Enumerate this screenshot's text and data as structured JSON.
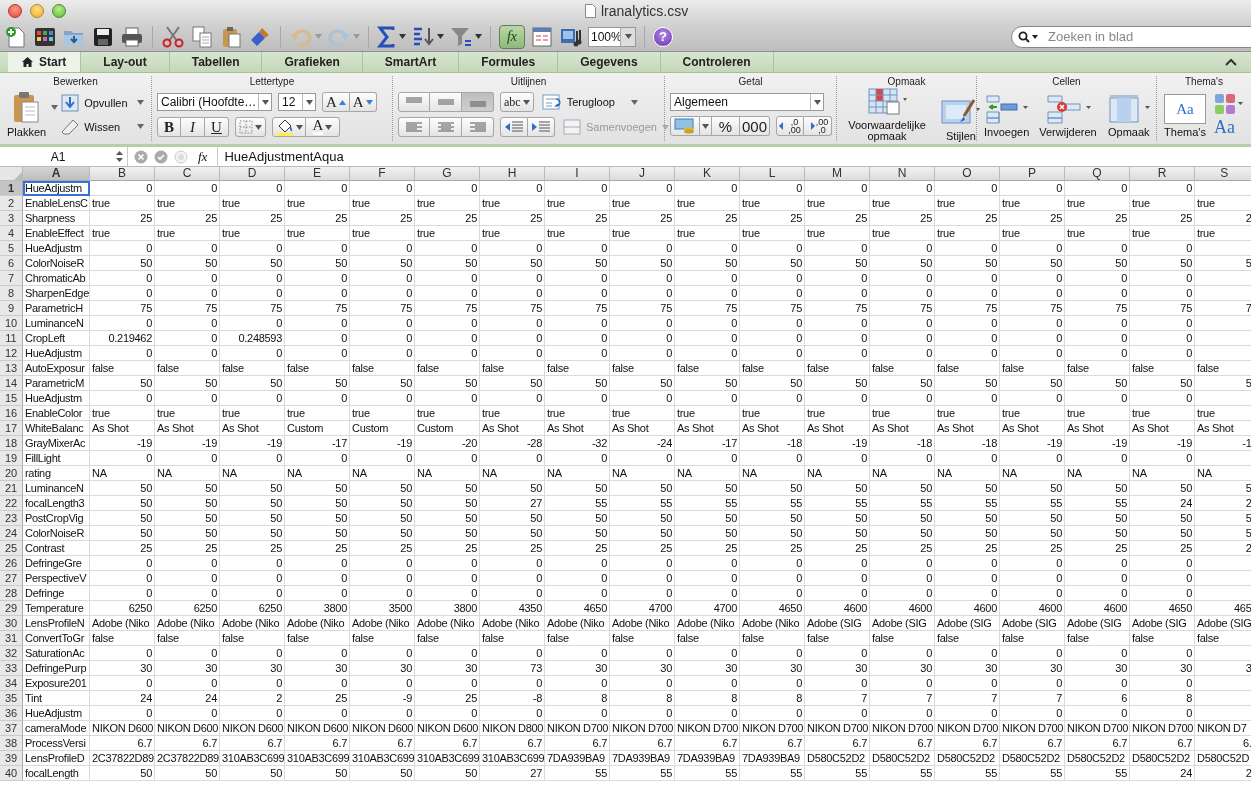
{
  "window": {
    "title": "lranalytics.csv"
  },
  "toolbar": {
    "zoom": "100%",
    "formula_toggle": {
      "label": "fx",
      "selected": true
    },
    "help": "?",
    "search": {
      "placeholder": "Zoeken in blad"
    }
  },
  "tabs": [
    {
      "label": "Start",
      "selected": true
    },
    {
      "label": "Lay-out",
      "selected": false
    },
    {
      "label": "Tabellen",
      "selected": false
    },
    {
      "label": "Grafieken",
      "selected": false
    },
    {
      "label": "SmartArt",
      "selected": false
    },
    {
      "label": "Formules",
      "selected": false
    },
    {
      "label": "Gegevens",
      "selected": false
    },
    {
      "label": "Controleren",
      "selected": false
    }
  ],
  "ribbon": {
    "edit": {
      "title": "Bewerken",
      "paste": "Plakken",
      "fill": "Opvullen",
      "clear": "Wissen"
    },
    "font": {
      "title": "Lettertype",
      "font_name": "Calibri (Hoofdte…",
      "font_size": "12",
      "grow": "A",
      "shrink": "A",
      "bold": "B",
      "italic": "I",
      "underline": "U",
      "font_color": "A"
    },
    "alignment": {
      "title": "Uitlijnen",
      "vertical_align": [
        {
          "selected": false
        },
        {
          "selected": false
        },
        {
          "selected": true
        }
      ],
      "orientation": "abc",
      "wrap": "Terugloop",
      "merge": {
        "label": "Samenvoegen",
        "disabled": true
      }
    },
    "number": {
      "title": "Getal",
      "format": "Algemeen",
      "percent": "%",
      "thousands": "000",
      "increase_decimal": [
        ",0",
        ",00"
      ],
      "decrease_decimal": [
        ",00",
        ",0"
      ]
    },
    "styles": {
      "title": "Opmaak",
      "conditional": "Voorwaardelijke opmaak",
      "styles": "Stijlen"
    },
    "cells": {
      "title": "Cellen",
      "insert": "Invoegen",
      "delete": "Verwijderen",
      "format": "Opmaak"
    },
    "themes": {
      "title": "Thema's",
      "preview": "Aa",
      "themes": "Thema's",
      "fonts": "Aa"
    }
  },
  "formula_bar": {
    "name_box": "A1",
    "fx": "fx",
    "formula": "HueAdjustmentAqua"
  },
  "sheet": {
    "columns": [
      {
        "label": "A",
        "selected": true
      },
      {
        "label": "B",
        "selected": false
      },
      {
        "label": "C",
        "selected": false
      },
      {
        "label": "D",
        "selected": false
      },
      {
        "label": "E",
        "selected": false
      },
      {
        "label": "F",
        "selected": false
      },
      {
        "label": "G",
        "selected": false
      },
      {
        "label": "H",
        "selected": false
      },
      {
        "label": "I",
        "selected": false
      },
      {
        "label": "J",
        "selected": false
      },
      {
        "label": "K",
        "selected": false
      },
      {
        "label": "L",
        "selected": false
      },
      {
        "label": "M",
        "selected": false
      },
      {
        "label": "N",
        "selected": false
      },
      {
        "label": "O",
        "selected": false
      },
      {
        "label": "P",
        "selected": false
      },
      {
        "label": "Q",
        "selected": false
      },
      {
        "label": "R",
        "selected": false
      },
      {
        "label": "S",
        "selected": false
      }
    ],
    "rows": [
      {
        "number": "1",
        "selected": true,
        "label": "HueAdjustm",
        "kind": "number",
        "cells": [
          "0",
          "0",
          "0",
          "0",
          "0",
          "0",
          "0",
          "0",
          "0",
          "0",
          "0",
          "0",
          "0",
          "0",
          "0",
          "0",
          "0"
        ]
      },
      {
        "number": "2",
        "selected": false,
        "label": "EnableLensC",
        "kind": "text",
        "cells": [
          "true",
          "true",
          "true",
          "true",
          "true",
          "true",
          "true",
          "true",
          "true",
          "true",
          "true",
          "true",
          "true",
          "true",
          "true",
          "true",
          "true",
          "true"
        ]
      },
      {
        "number": "3",
        "selected": false,
        "label": "Sharpness",
        "kind": "number",
        "cells": [
          "25",
          "25",
          "25",
          "25",
          "25",
          "25",
          "25",
          "25",
          "25",
          "25",
          "25",
          "25",
          "25",
          "25",
          "25",
          "25",
          "25",
          "2"
        ]
      },
      {
        "number": "4",
        "selected": false,
        "label": "EnableEffect",
        "kind": "text",
        "cells": [
          "true",
          "true",
          "true",
          "true",
          "true",
          "true",
          "true",
          "true",
          "true",
          "true",
          "true",
          "true",
          "true",
          "true",
          "true",
          "true",
          "true",
          "true"
        ]
      },
      {
        "number": "5",
        "selected": false,
        "label": "HueAdjustm",
        "kind": "number",
        "cells": [
          "0",
          "0",
          "0",
          "0",
          "0",
          "0",
          "0",
          "0",
          "0",
          "0",
          "0",
          "0",
          "0",
          "0",
          "0",
          "0",
          "0"
        ]
      },
      {
        "number": "6",
        "selected": false,
        "label": "ColorNoiseR",
        "kind": "number",
        "cells": [
          "50",
          "50",
          "50",
          "50",
          "50",
          "50",
          "50",
          "50",
          "50",
          "50",
          "50",
          "50",
          "50",
          "50",
          "50",
          "50",
          "50",
          "5"
        ]
      },
      {
        "number": "7",
        "selected": false,
        "label": "ChromaticAb",
        "kind": "number",
        "cells": [
          "0",
          "0",
          "0",
          "0",
          "0",
          "0",
          "0",
          "0",
          "0",
          "0",
          "0",
          "0",
          "0",
          "0",
          "0",
          "0",
          "0"
        ]
      },
      {
        "number": "8",
        "selected": false,
        "label": "SharpenEdge",
        "kind": "number",
        "cells": [
          "0",
          "0",
          "0",
          "0",
          "0",
          "0",
          "0",
          "0",
          "0",
          "0",
          "0",
          "0",
          "0",
          "0",
          "0",
          "0",
          "0"
        ]
      },
      {
        "number": "9",
        "selected": false,
        "label": "ParametricH",
        "kind": "number",
        "cells": [
          "75",
          "75",
          "75",
          "75",
          "75",
          "75",
          "75",
          "75",
          "75",
          "75",
          "75",
          "75",
          "75",
          "75",
          "75",
          "75",
          "75",
          "7"
        ]
      },
      {
        "number": "10",
        "selected": false,
        "label": "LuminanceN",
        "kind": "number",
        "cells": [
          "0",
          "0",
          "0",
          "0",
          "0",
          "0",
          "0",
          "0",
          "0",
          "0",
          "0",
          "0",
          "0",
          "0",
          "0",
          "0",
          "0"
        ]
      },
      {
        "number": "11",
        "selected": false,
        "label": "CropLeft",
        "kind": "number",
        "cells": [
          "0.219462",
          "0",
          "0.248593",
          "0",
          "0",
          "0",
          "0",
          "0",
          "0",
          "0",
          "0",
          "0",
          "0",
          "0",
          "0",
          "0",
          "0"
        ]
      },
      {
        "number": "12",
        "selected": false,
        "label": "HueAdjustm",
        "kind": "number",
        "cells": [
          "0",
          "0",
          "0",
          "0",
          "0",
          "0",
          "0",
          "0",
          "0",
          "0",
          "0",
          "0",
          "0",
          "0",
          "0",
          "0",
          "0"
        ]
      },
      {
        "number": "13",
        "selected": false,
        "label": "AutoExposur",
        "kind": "text",
        "cells": [
          "false",
          "false",
          "false",
          "false",
          "false",
          "false",
          "false",
          "false",
          "false",
          "false",
          "false",
          "false",
          "false",
          "false",
          "false",
          "false",
          "false",
          "false"
        ]
      },
      {
        "number": "14",
        "selected": false,
        "label": "ParametricM",
        "kind": "number",
        "cells": [
          "50",
          "50",
          "50",
          "50",
          "50",
          "50",
          "50",
          "50",
          "50",
          "50",
          "50",
          "50",
          "50",
          "50",
          "50",
          "50",
          "50",
          "5"
        ]
      },
      {
        "number": "15",
        "selected": false,
        "label": "HueAdjustm",
        "kind": "number",
        "cells": [
          "0",
          "0",
          "0",
          "0",
          "0",
          "0",
          "0",
          "0",
          "0",
          "0",
          "0",
          "0",
          "0",
          "0",
          "0",
          "0",
          "0"
        ]
      },
      {
        "number": "16",
        "selected": false,
        "label": "EnableColor",
        "kind": "text",
        "cells": [
          "true",
          "true",
          "true",
          "true",
          "true",
          "true",
          "true",
          "true",
          "true",
          "true",
          "true",
          "true",
          "true",
          "true",
          "true",
          "true",
          "true",
          "true"
        ]
      },
      {
        "number": "17",
        "selected": false,
        "label": "WhiteBalanc",
        "kind": "text",
        "cells": [
          "As Shot",
          "As Shot",
          "As Shot",
          "Custom",
          "Custom",
          "Custom",
          "As Shot",
          "As Shot",
          "As Shot",
          "As Shot",
          "As Shot",
          "As Shot",
          "As Shot",
          "As Shot",
          "As Shot",
          "As Shot",
          "As Shot",
          "As Shot"
        ]
      },
      {
        "number": "18",
        "selected": false,
        "label": "GrayMixerAc",
        "kind": "number",
        "cells": [
          "-19",
          "-19",
          "-19",
          "-17",
          "-19",
          "-20",
          "-28",
          "-32",
          "-24",
          "-17",
          "-18",
          "-19",
          "-18",
          "-18",
          "-19",
          "-19",
          "-19",
          "-1"
        ]
      },
      {
        "number": "19",
        "selected": false,
        "label": "FillLight",
        "kind": "number",
        "cells": [
          "0",
          "0",
          "0",
          "0",
          "0",
          "0",
          "0",
          "0",
          "0",
          "0",
          "0",
          "0",
          "0",
          "0",
          "0",
          "0",
          "0"
        ]
      },
      {
        "number": "20",
        "selected": false,
        "label": "rating",
        "kind": "text",
        "cells": [
          "NA",
          "NA",
          "NA",
          "NA",
          "NA",
          "NA",
          "NA",
          "NA",
          "NA",
          "NA",
          "NA",
          "NA",
          "NA",
          "NA",
          "NA",
          "NA",
          "NA",
          "NA"
        ]
      },
      {
        "number": "21",
        "selected": false,
        "label": "LuminanceN",
        "kind": "number",
        "cells": [
          "50",
          "50",
          "50",
          "50",
          "50",
          "50",
          "50",
          "50",
          "50",
          "50",
          "50",
          "50",
          "50",
          "50",
          "50",
          "50",
          "50",
          "5"
        ]
      },
      {
        "number": "22",
        "selected": false,
        "label": "focalLength3",
        "kind": "number",
        "cells": [
          "50",
          "50",
          "50",
          "50",
          "50",
          "50",
          "27",
          "55",
          "55",
          "55",
          "55",
          "55",
          "55",
          "55",
          "55",
          "55",
          "24",
          "2"
        ]
      },
      {
        "number": "23",
        "selected": false,
        "label": "PostCropVig",
        "kind": "number",
        "cells": [
          "50",
          "50",
          "50",
          "50",
          "50",
          "50",
          "50",
          "50",
          "50",
          "50",
          "50",
          "50",
          "50",
          "50",
          "50",
          "50",
          "50",
          "5"
        ]
      },
      {
        "number": "24",
        "selected": false,
        "label": "ColorNoiseR",
        "kind": "number",
        "cells": [
          "50",
          "50",
          "50",
          "50",
          "50",
          "50",
          "50",
          "50",
          "50",
          "50",
          "50",
          "50",
          "50",
          "50",
          "50",
          "50",
          "50",
          "5"
        ]
      },
      {
        "number": "25",
        "selected": false,
        "label": "Contrast",
        "kind": "number",
        "cells": [
          "25",
          "25",
          "25",
          "25",
          "25",
          "25",
          "25",
          "25",
          "25",
          "25",
          "25",
          "25",
          "25",
          "25",
          "25",
          "25",
          "25",
          "2"
        ]
      },
      {
        "number": "26",
        "selected": false,
        "label": "DefringeGre",
        "kind": "number",
        "cells": [
          "0",
          "0",
          "0",
          "0",
          "0",
          "0",
          "0",
          "0",
          "0",
          "0",
          "0",
          "0",
          "0",
          "0",
          "0",
          "0",
          "0"
        ]
      },
      {
        "number": "27",
        "selected": false,
        "label": "PerspectiveV",
        "kind": "number",
        "cells": [
          "0",
          "0",
          "0",
          "0",
          "0",
          "0",
          "0",
          "0",
          "0",
          "0",
          "0",
          "0",
          "0",
          "0",
          "0",
          "0",
          "0"
        ]
      },
      {
        "number": "28",
        "selected": false,
        "label": "Defringe",
        "kind": "number",
        "cells": [
          "0",
          "0",
          "0",
          "0",
          "0",
          "0",
          "0",
          "0",
          "0",
          "0",
          "0",
          "0",
          "0",
          "0",
          "0",
          "0",
          "0"
        ]
      },
      {
        "number": "29",
        "selected": false,
        "label": "Temperature",
        "kind": "number",
        "cells": [
          "6250",
          "6250",
          "6250",
          "3800",
          "3500",
          "3800",
          "4350",
          "4650",
          "4700",
          "4700",
          "4650",
          "4600",
          "4600",
          "4600",
          "4600",
          "4600",
          "4650",
          "465"
        ]
      },
      {
        "number": "30",
        "selected": false,
        "label": "LensProfileN",
        "kind": "text",
        "cells": [
          "Adobe (Niko",
          "Adobe (Niko",
          "Adobe (Niko",
          "Adobe (Niko",
          "Adobe (Niko",
          "Adobe (Niko",
          "Adobe (Niko",
          "Adobe (Niko",
          "Adobe (Niko",
          "Adobe (Niko",
          "Adobe (Niko",
          "Adobe (SIG",
          "Adobe (SIG",
          "Adobe (SIG",
          "Adobe (SIG",
          "Adobe (SIG",
          "Adobe (SIG",
          "Adobe (SIG"
        ]
      },
      {
        "number": "31",
        "selected": false,
        "label": "ConvertToGr",
        "kind": "text",
        "cells": [
          "false",
          "false",
          "false",
          "false",
          "false",
          "false",
          "false",
          "false",
          "false",
          "false",
          "false",
          "false",
          "false",
          "false",
          "false",
          "false",
          "false",
          "false"
        ]
      },
      {
        "number": "32",
        "selected": false,
        "label": "SaturationAc",
        "kind": "number",
        "cells": [
          "0",
          "0",
          "0",
          "0",
          "0",
          "0",
          "0",
          "0",
          "0",
          "0",
          "0",
          "0",
          "0",
          "0",
          "0",
          "0",
          "0"
        ]
      },
      {
        "number": "33",
        "selected": false,
        "label": "DefringePurp",
        "kind": "number",
        "cells": [
          "30",
          "30",
          "30",
          "30",
          "30",
          "30",
          "73",
          "30",
          "30",
          "30",
          "30",
          "30",
          "30",
          "30",
          "30",
          "30",
          "30",
          "3"
        ]
      },
      {
        "number": "34",
        "selected": false,
        "label": "Exposure201",
        "kind": "number",
        "cells": [
          "0",
          "0",
          "0",
          "0",
          "0",
          "0",
          "0",
          "0",
          "0",
          "0",
          "0",
          "0",
          "0",
          "0",
          "0",
          "0",
          "0"
        ]
      },
      {
        "number": "35",
        "selected": false,
        "label": "Tint",
        "kind": "number",
        "cells": [
          "24",
          "24",
          "2",
          "25",
          "-9",
          "25",
          "-8",
          "8",
          "8",
          "8",
          "8",
          "7",
          "7",
          "7",
          "7",
          "6",
          "8"
        ]
      },
      {
        "number": "36",
        "selected": false,
        "label": "HueAdjustm",
        "kind": "number",
        "cells": [
          "0",
          "0",
          "0",
          "0",
          "0",
          "0",
          "0",
          "0",
          "0",
          "0",
          "0",
          "0",
          "0",
          "0",
          "0",
          "0",
          "0"
        ]
      },
      {
        "number": "37",
        "selected": false,
        "label": "cameraMode",
        "kind": "text",
        "cells": [
          "NIKON D600",
          "NIKON D600",
          "NIKON D600",
          "NIKON D600",
          "NIKON D600",
          "NIKON D600",
          "NIKON D800",
          "NIKON D700",
          "NIKON D700",
          "NIKON D700",
          "NIKON D700",
          "NIKON D700",
          "NIKON D700",
          "NIKON D700",
          "NIKON D700",
          "NIKON D700",
          "NIKON D700",
          "NIKON D7"
        ]
      },
      {
        "number": "38",
        "selected": false,
        "label": "ProcessVersi",
        "kind": "number",
        "cells": [
          "6.7",
          "6.7",
          "6.7",
          "6.7",
          "6.7",
          "6.7",
          "6.7",
          "6.7",
          "6.7",
          "6.7",
          "6.7",
          "6.7",
          "6.7",
          "6.7",
          "6.7",
          "6.7",
          "6.7",
          "6."
        ]
      },
      {
        "number": "39",
        "selected": false,
        "label": "LensProfileD",
        "kind": "text",
        "cells": [
          "2C37822D89",
          "2C37822D89",
          "310AB3C699",
          "310AB3C699",
          "310AB3C699",
          "310AB3C699",
          "310AB3C699",
          "7DA939BA9",
          "7DA939BA9",
          "7DA939BA9",
          "7DA939BA9",
          "D580C52D2",
          "D580C52D2",
          "D580C52D2",
          "D580C52D2",
          "D580C52D2",
          "D580C52D2",
          "D580C52D"
        ]
      },
      {
        "number": "40",
        "selected": false,
        "label": "focalLength",
        "kind": "number",
        "cells": [
          "50",
          "50",
          "50",
          "50",
          "50",
          "50",
          "27",
          "55",
          "55",
          "55",
          "55",
          "55",
          "55",
          "55",
          "55",
          "55",
          "24",
          "2"
        ]
      }
    ]
  }
}
